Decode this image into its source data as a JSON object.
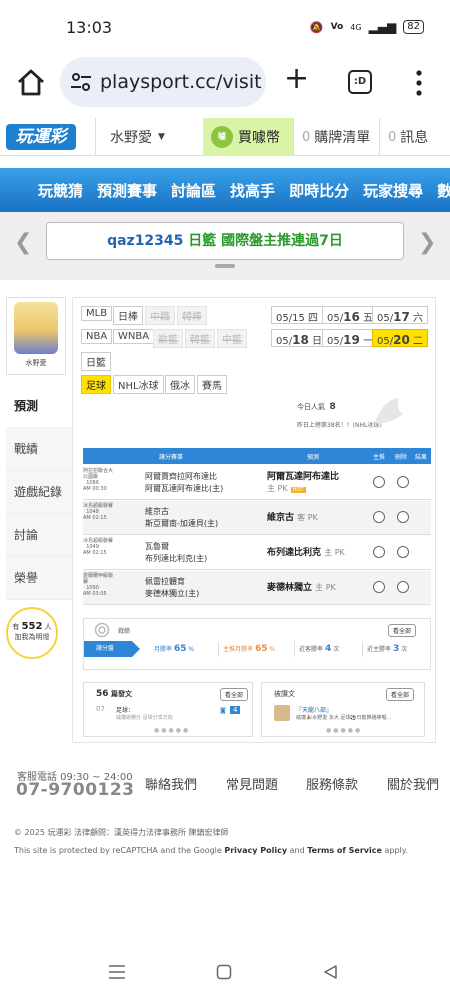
{
  "status": {
    "time": "13:03",
    "battery": "82",
    "net": "4G"
  },
  "browser": {
    "url": "playsport.cc/visit",
    "tabs_label": ":D"
  },
  "site": {
    "logo": "玩運彩",
    "user": "水野愛",
    "coins": "買噱幣",
    "coin_icon": "噱",
    "cart_count": "0",
    "cart_label": "購牌清單",
    "msg_count": "0",
    "msg_label": "訊息"
  },
  "nav": [
    "玩競猜",
    "預測賽事",
    "討論區",
    "找高手",
    "即時比分",
    "玩家搜尋",
    "數據"
  ],
  "banner": {
    "user": "qaz12345",
    "text": "日籃 國際盤主推連過7日"
  },
  "profile": {
    "name": "水野愛"
  },
  "side_menu": [
    "預測",
    "戰績",
    "遊戲紀錄",
    "討論",
    "榮譽"
  ],
  "bulb": {
    "prefix": "有",
    "count": "552",
    "unit": "人",
    "suffix": "加我為明燈"
  },
  "leagues": {
    "row1": [
      "MLB",
      "日棒",
      "中職",
      "韓棒"
    ],
    "row2": [
      "NBA",
      "WNBA",
      "歐籃",
      "韓籃",
      "中籃"
    ],
    "row3": [
      "日籃"
    ],
    "row4": [
      "足球",
      "NHL冰球",
      "俄冰",
      "賽馬"
    ]
  },
  "dates": {
    "d1": {
      "m": "05/",
      "d": "15",
      "w": "四"
    },
    "d2": {
      "m": "05/",
      "d": "16",
      "w": "五"
    },
    "d3": {
      "m": "05/",
      "d": "17",
      "w": "六"
    },
    "d4": {
      "m": "05/",
      "d": "18",
      "w": "日"
    },
    "d5": {
      "m": "05/",
      "d": "19",
      "w": "一"
    },
    "d6": {
      "m": "05/",
      "d": "20",
      "w": "二"
    }
  },
  "today": {
    "label": "今日人氣",
    "value": "8",
    "rank": "昨日上榜第38名！！(NHL冰球)"
  },
  "table": {
    "headers": [
      "讓分賽事",
      "預測",
      "主推",
      "刪除",
      "結果"
    ],
    "rows": [
      {
        "league": "阿拉伯聯合大公國聯",
        "num": "1086",
        "time": "AM 00:30",
        "home": "阿爾賈齊拉阿布達比",
        "away": "阿爾瓦達阿布達比(主)",
        "pick": "阿爾瓦達阿布達比",
        "type": "主 PK",
        "hot": "HOT"
      },
      {
        "league": "冰島超級聯賽",
        "num": "1048",
        "time": "AM 02:15",
        "home": "維京古",
        "away": "斯亞爾南-加達貝(主)",
        "pick": "維京古",
        "type": "客 PK",
        "hot": ""
      },
      {
        "league": "冰島超級聯賽",
        "num": "1049",
        "time": "AM 02:15",
        "home": "瓦魯爾",
        "away": "布列達比利克(主)",
        "pick": "布列達比利克",
        "type": "主 PK",
        "hot": ""
      },
      {
        "league": "愛爾蘭甲級聯賽",
        "num": "1090",
        "time": "AM 03:05",
        "home": "佩雷拉體育",
        "away": "麥德林獨立(主)",
        "pick": "麥德林獨立",
        "type": "主 PK",
        "hot": ""
      }
    ]
  },
  "record": {
    "title": "戰績",
    "more": "看全部",
    "tab": "讓分盤",
    "month_rate": {
      "label": "月勝率",
      "value": "65",
      "unit": "%"
    },
    "main_rate": {
      "label": "主推月勝率",
      "value": "65",
      "unit": "%"
    },
    "streak1": {
      "label": "近客勝率",
      "value": "4",
      "unit": "次"
    },
    "streak2": {
      "label": "近主勝率",
      "value": "3",
      "unit": "次"
    }
  },
  "posts": {
    "count": "56",
    "title": "篇發文",
    "more": "看全部",
    "item_date": "07",
    "item_tag": "足球：",
    "item_text": "威廉斯勝分 足球分享方向",
    "badge": "4"
  },
  "replies": {
    "title": "被讚文",
    "more": "看全部",
    "item_title": "『天龍八部』",
    "item_text": "威廉🎉水野愛 永大 足球⚽日籃推播棒喔..."
  },
  "footer": {
    "svc": "客服電話 09:30 ~ 24:00",
    "phone": "07-9700123",
    "links": [
      "聯絡我們",
      "常見問題",
      "服務條款",
      "關於我們"
    ],
    "copyright": "© 2025 玩運彩 法律顧問：漢英得力法律事務所 陳鎮宏律師",
    "recaptcha_pre": "This site is protected by reCAPTCHA and the Google",
    "privacy": "Privacy Policy",
    "and": "and",
    "terms": "Terms of Service",
    "apply": "apply."
  }
}
